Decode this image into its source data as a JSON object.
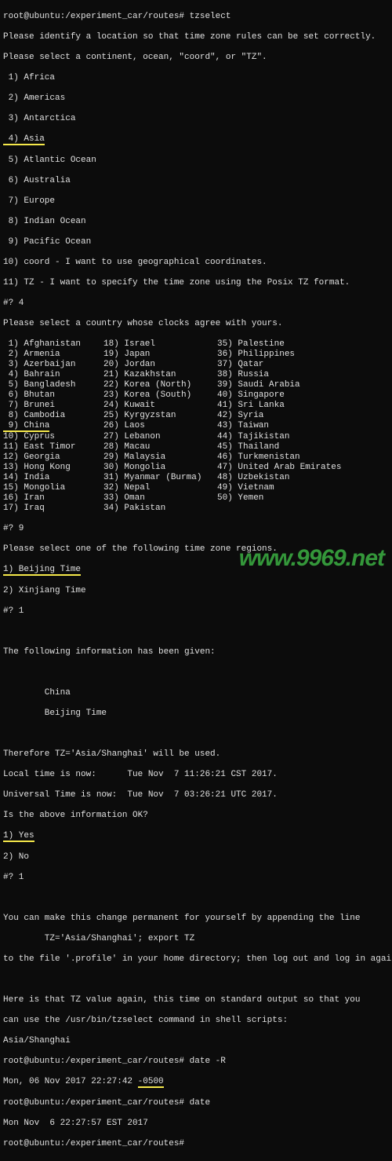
{
  "prompt_line1": "root@ubuntu:/experiment_car/routes# tzselect",
  "intro1": "Please identify a location so that time zone rules can be set correctly.",
  "intro2": "Please select a continent, ocean, \"coord\", or \"TZ\".",
  "continents": [
    " 1) Africa",
    " 2) Americas",
    " 3) Antarctica",
    " 4) Asia",
    " 5) Atlantic Ocean",
    " 6) Australia",
    " 7) Europe",
    " 8) Indian Ocean",
    " 9) Pacific Ocean",
    "10) coord - I want to use geographical coordinates.",
    "11) TZ - I want to specify the time zone using the Posix TZ format."
  ],
  "continent_answer": "#? 4",
  "country_prompt": "Please select a country whose clocks agree with yours.",
  "countries": [
    [
      " 1) Afghanistan",
      "18) Israel",
      "35) Palestine"
    ],
    [
      " 2) Armenia",
      "19) Japan",
      "36) Philippines"
    ],
    [
      " 3) Azerbaijan",
      "20) Jordan",
      "37) Qatar"
    ],
    [
      " 4) Bahrain",
      "21) Kazakhstan",
      "38) Russia"
    ],
    [
      " 5) Bangladesh",
      "22) Korea (North)",
      "39) Saudi Arabia"
    ],
    [
      " 6) Bhutan",
      "23) Korea (South)",
      "40) Singapore"
    ],
    [
      " 7) Brunei",
      "24) Kuwait",
      "41) Sri Lanka"
    ],
    [
      " 8) Cambodia",
      "25) Kyrgyzstan",
      "42) Syria"
    ],
    [
      " 9) China",
      "26) Laos",
      "43) Taiwan"
    ],
    [
      "10) Cyprus",
      "27) Lebanon",
      "44) Tajikistan"
    ],
    [
      "11) East Timor",
      "28) Macau",
      "45) Thailand"
    ],
    [
      "12) Georgia",
      "29) Malaysia",
      "46) Turkmenistan"
    ],
    [
      "13) Hong Kong",
      "30) Mongolia",
      "47) United Arab Emirates"
    ],
    [
      "14) India",
      "31) Myanmar (Burma)",
      "48) Uzbekistan"
    ],
    [
      "15) Mongolia",
      "32) Nepal",
      "49) Vietnam"
    ],
    [
      "16) Iran",
      "33) Oman",
      "50) Yemen"
    ],
    [
      "17) Iraq",
      "34) Pakistan",
      ""
    ]
  ],
  "country_answer": "#? 9",
  "region_prompt": "Please select one of the following time zone regions.",
  "regions": [
    "1) Beijing Time",
    "2) Xinjiang Time"
  ],
  "region_answer": "#? 1",
  "info_header": "The following information has been given:",
  "info_china": "        China",
  "info_bj": "        Beijing Time",
  "tz_line": "Therefore TZ='Asia/Shanghai' will be used.",
  "local_time": "Local time is now:      Tue Nov  7 11:26:21 CST 2017.",
  "utc_time": "Universal Time is now:  Tue Nov  7 03:26:21 UTC 2017.",
  "confirm_q": "Is the above information OK?",
  "confirm_opts": [
    "1) Yes",
    "2) No"
  ],
  "confirm_answer": "#? 1",
  "perm1": "You can make this change permanent for yourself by appending the line",
  "perm2": "        TZ='Asia/Shanghai'; export TZ",
  "perm3": "to the file '.profile' in your home directory; then log out and log in again.",
  "std1": "Here is that TZ value again, this time on standard output so that you",
  "std2": "can use the /usr/bin/tzselect command in shell scripts:",
  "std3": "Asia/Shanghai",
  "date_cmd": "root@ubuntu:/experiment_car/routes# date -R",
  "date_out_pre": "Mon, 06 Nov 2017 22:27:42 ",
  "date_out_hl": "-0500",
  "date_cmd2": "root@ubuntu:/experiment_car/routes# date",
  "date_out2": "Mon Nov  6 22:27:57 EST 2017",
  "final_prompt": "root@ubuntu:/experiment_car/routes# ",
  "watermark": "www.9969.net"
}
